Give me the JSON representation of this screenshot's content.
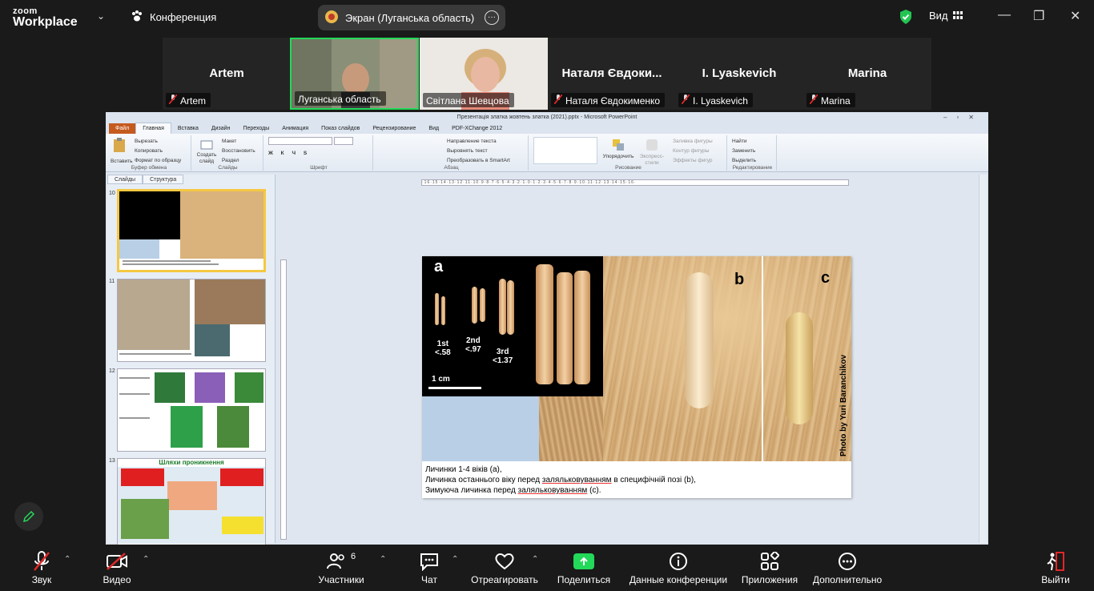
{
  "app": {
    "logo_line1": "zoom",
    "logo_line2": "Workplace"
  },
  "topbar": {
    "conference_tab": "Конференция",
    "screen_share_label": "Экран (Луганська область)",
    "view_label": "Вид"
  },
  "participants": [
    {
      "display_name": "Artem",
      "label": "Artem",
      "muted": true,
      "video": false
    },
    {
      "display_name": "",
      "label": "Луганська область",
      "muted": false,
      "video": true,
      "active": true
    },
    {
      "display_name": "",
      "label": "Світлана Шевцова",
      "muted": false,
      "video": true
    },
    {
      "display_name": "Наталя Євдоки...",
      "label": "Наталя Євдокименко",
      "muted": true,
      "video": false
    },
    {
      "display_name": "I. Lyaskevich",
      "label": "I. Lyaskevich",
      "muted": true,
      "video": false
    },
    {
      "display_name": "Marina",
      "label": "Marina",
      "muted": true,
      "video": false
    }
  ],
  "ppt": {
    "window_title": "Презентація златка жовтень златка (2021).pptx - Microsoft PowerPoint",
    "tabs": [
      "Файл",
      "Главная",
      "Вставка",
      "Дизайн",
      "Переходы",
      "Анимация",
      "Показ слайдов",
      "Рецензирование",
      "Вид",
      "PDF-XChange 2012"
    ],
    "ribbon": {
      "clipboard": {
        "name": "Буфер обмена",
        "paste": "Вставить",
        "cut": "Вырезать",
        "copy": "Копировать",
        "format": "Формат по образцу"
      },
      "slides": {
        "name": "Слайды",
        "create": "Создать слайд",
        "layout": "Макет",
        "restore": "Восстановить",
        "section": "Раздел"
      },
      "font": {
        "name": "Шрифт"
      },
      "paragraph": {
        "name": "Абзац",
        "direction": "Направление текста",
        "align": "Выровнять текст",
        "smartart": "Преобразовать в SmartArt"
      },
      "drawing": {
        "name": "Рисование",
        "arrange": "Упорядочить",
        "styles": "Экспресс-стили",
        "fill": "Заливка фигуры",
        "outline": "Контур фигуры",
        "effects": "Эффекты фигур"
      },
      "editing": {
        "name": "Редактирование",
        "find": "Найти",
        "replace": "Заменить",
        "select": "Выделить"
      }
    },
    "pane_tabs": [
      "Слайды",
      "Структура"
    ],
    "thumbnails": [
      {
        "num": "10",
        "selected": true
      },
      {
        "num": "11",
        "selected": false
      },
      {
        "num": "12",
        "selected": false
      },
      {
        "num": "13",
        "selected": false,
        "title": "Шляхи проникнення"
      }
    ],
    "slide": {
      "label_a": "a",
      "label_b": "b",
      "label_c": "c",
      "stage1": "1st\n<.58",
      "stage2": "2nd\n<.97",
      "stage3": "3rd\n<1.37",
      "scale": "1 cm",
      "credit": "Photo by Yuri Baranchikov",
      "caption_line1": "Личинки  1-4 віків  (a),",
      "caption_line2_a": "Личинка  останнього віку перед ",
      "caption_line2_u": "заляльковуванням",
      "caption_line2_b": "  в специфічній  позі (b),",
      "caption_line3_a": "Зимуюча  личинка  перед  ",
      "caption_line3_u": "заляльковуванням",
      "caption_line3_b": "  (c)."
    }
  },
  "toolbar": {
    "audio": "Звук",
    "video": "Видео",
    "participants": "Участники",
    "participants_count": "6",
    "chat": "Чат",
    "react": "Отреагировать",
    "share": "Поделиться",
    "info": "Данные конференции",
    "apps": "Приложения",
    "more": "Дополнительно",
    "leave": "Выйти"
  }
}
